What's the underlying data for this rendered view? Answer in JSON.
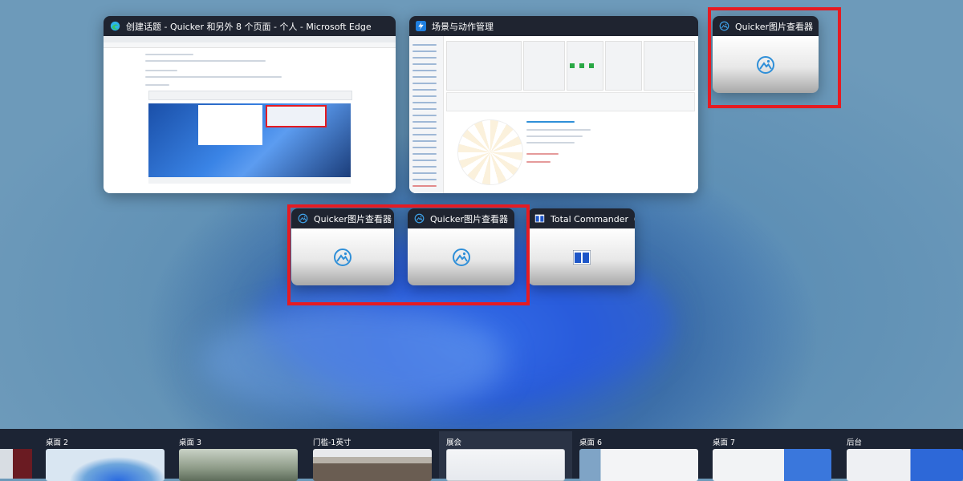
{
  "windows": {
    "edge": {
      "title": "创建话题 - Quicker 和另外 8 个页面 - 个人 - Microsoft Edge",
      "icon": "edge-icon"
    },
    "scene": {
      "title": "场景与动作管理",
      "icon": "quicker-icon"
    },
    "viewer1": {
      "title": "Quicker图片查看器",
      "icon": "image-viewer-icon"
    },
    "viewer2": {
      "title": "Quicker图片查看器",
      "icon": "image-viewer-icon"
    },
    "viewer3": {
      "title": "Quicker图片查看器",
      "icon": "image-viewer-icon"
    },
    "tc": {
      "title": "Total Commander（在接...",
      "icon": "total-commander-icon"
    }
  },
  "desktops": [
    {
      "label": "桌面 2"
    },
    {
      "label": "桌面 3"
    },
    {
      "label": "门槛-1英寸"
    },
    {
      "label": "展会"
    },
    {
      "label": "桌面 6"
    },
    {
      "label": "桌面 7"
    },
    {
      "label": "后台"
    }
  ],
  "colors": {
    "highlight": "#e51b22",
    "titlebar": "#1f2430",
    "taskbar": "#1c2434",
    "accent": "#2f8fd8"
  }
}
